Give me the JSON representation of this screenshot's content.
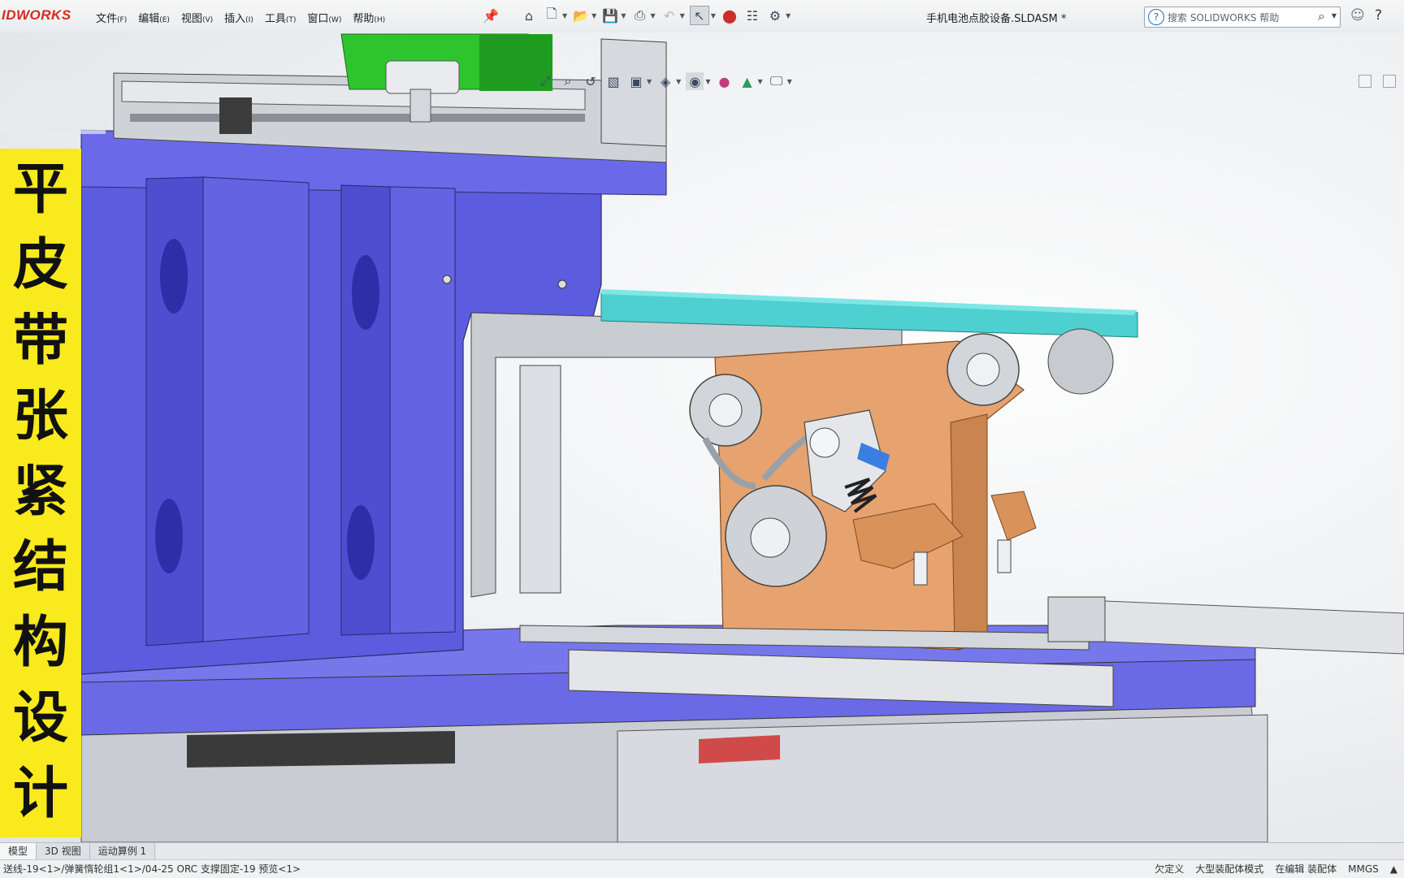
{
  "app": {
    "brand_left": "ID",
    "brand_right": "WORKS",
    "document_title": "手机电池点胶设备.SLDASM *"
  },
  "menu": [
    {
      "label": "文件",
      "key": "(F)"
    },
    {
      "label": "编辑",
      "key": "(E)"
    },
    {
      "label": "视图",
      "key": "(V)"
    },
    {
      "label": "插入",
      "key": "(I)"
    },
    {
      "label": "工具",
      "key": "(T)"
    },
    {
      "label": "窗口",
      "key": "(W)"
    },
    {
      "label": "帮助",
      "key": "(H)"
    }
  ],
  "search": {
    "placeholder": "搜索 SOLIDWORKS 帮助"
  },
  "caption": {
    "chars": [
      "平",
      "皮",
      "带",
      "张",
      "紧",
      "结",
      "构",
      "设",
      "计"
    ]
  },
  "tabs": [
    {
      "label": "模型"
    },
    {
      "label": "3D 视图"
    },
    {
      "label": "运动算例 1"
    }
  ],
  "status": {
    "path": "送线-19<1>/弹簧惰轮组1<1>/04-25 ORC 支撑固定-19 预览<1>",
    "underdefined": "欠定义",
    "large_assembly": "大型装配体模式",
    "editing": "在编辑 装配体",
    "units": "MMGS"
  },
  "colors": {
    "frame_blue": "#5f5fe0",
    "belt_cyan": "#52d6d6",
    "bracket_orange": "#e6a36f",
    "block_green": "#2ec42e",
    "caption_yellow": "#f8ea1c"
  }
}
